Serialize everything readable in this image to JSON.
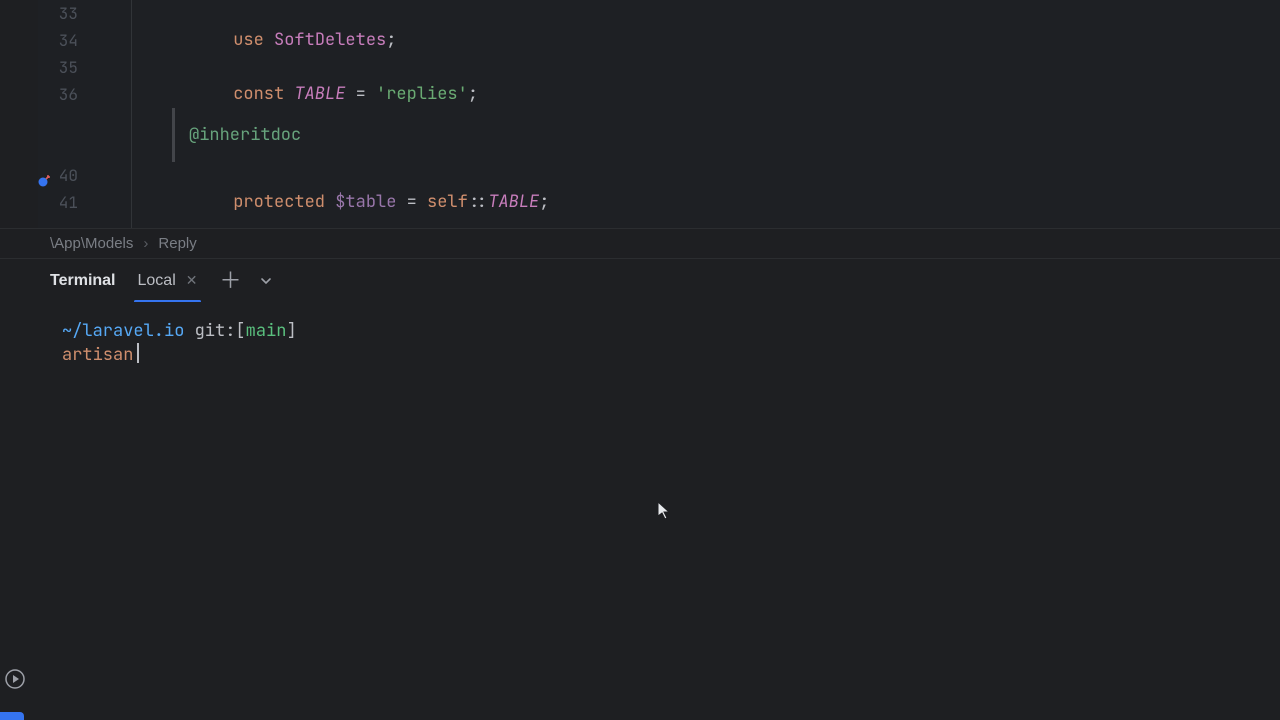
{
  "editor": {
    "lines": {
      "l33": "33",
      "l34": "34",
      "l35": "35",
      "l36": "36",
      "l40": "40",
      "l41": "41"
    },
    "code": {
      "use_kw": "use",
      "softdeletes": "SoftDeletes",
      "semicolon": ";",
      "const_kw": "const",
      "table_const": "TABLE",
      "eq": " = ",
      "replies_str": "'replies'",
      "inheritdoc": "@inheritdoc",
      "protected_kw": "protected",
      "table_var": "$table",
      "self_kw": "self",
      "dcolon": "::",
      "table_ref": "TABLE"
    }
  },
  "breadcrumb": {
    "ns": "\\App\\Models",
    "cls": "Reply"
  },
  "terminal": {
    "title": "Terminal",
    "tab_label": "Local",
    "prompt": {
      "path": "~/laravel.io",
      "git": "git:",
      "lbrack": "[",
      "branch": "main",
      "rbrack": "]"
    },
    "command": "artisan"
  }
}
